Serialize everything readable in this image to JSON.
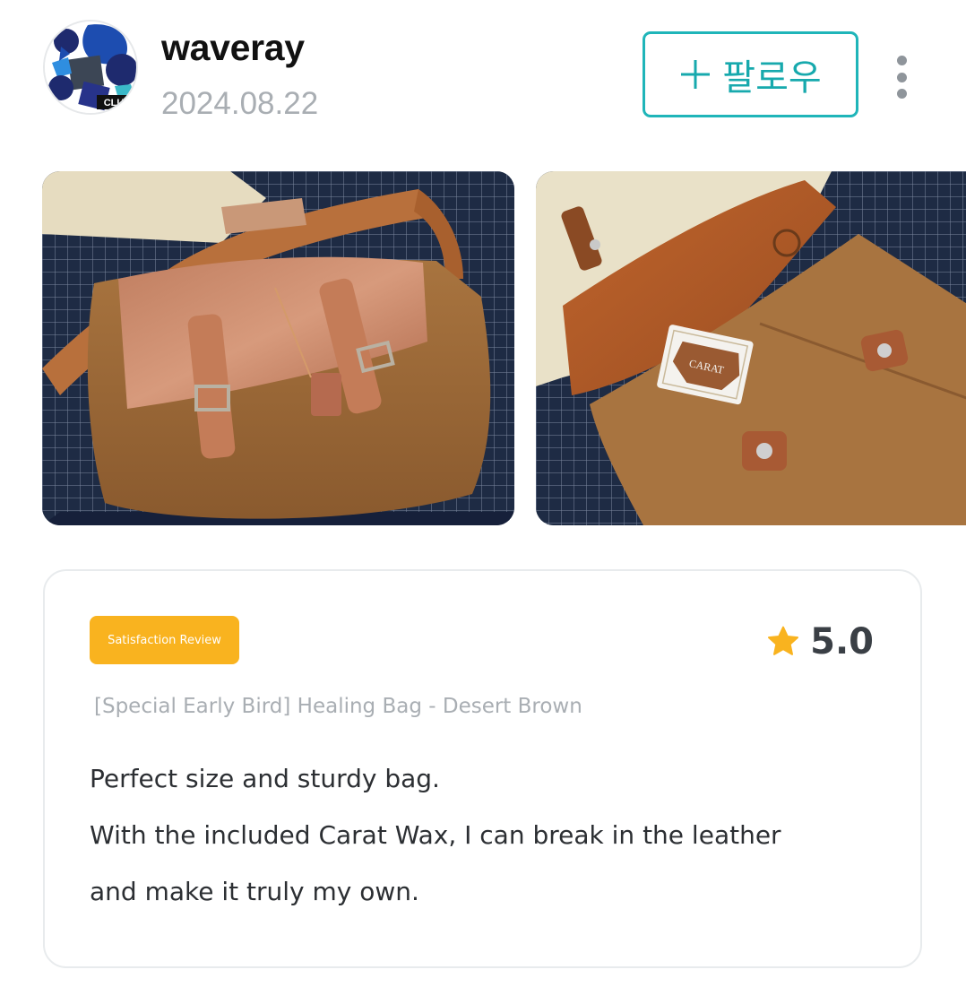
{
  "author": {
    "username": "waveray",
    "date": "2024.08.22",
    "avatar_badge": "CLUB"
  },
  "actions": {
    "follow_label": "팔로우",
    "follow_icon": "plus-icon",
    "more_icon": "more-vertical-icon"
  },
  "photos": [
    {
      "icon": "bag-photo-front"
    },
    {
      "icon": "bag-photo-open-with-wax"
    }
  ],
  "photo_2_product_text": "CARAT",
  "review": {
    "badge": "Satisfaction Review",
    "rating": "5.0",
    "rating_icon": "star-icon",
    "product": "[Special Early Bird] Healing Bag - Desert Brown",
    "lines": [
      "Perfect size and sturdy bag.",
      "With the included Carat Wax, I can break in the leather",
      "and make it truly my own."
    ]
  },
  "colors": {
    "accent_teal": "#1fb5b9",
    "badge_yellow": "#f9b31f",
    "star_yellow": "#f9b31f",
    "muted_text": "#a9aeb3"
  }
}
